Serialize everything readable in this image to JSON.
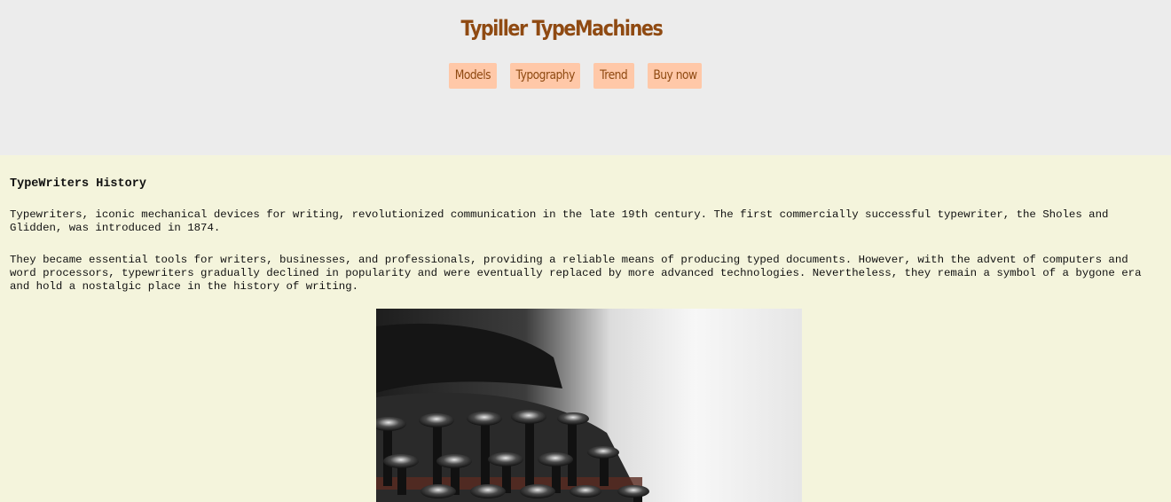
{
  "header": {
    "title": "Typiller TypeMachines",
    "nav": [
      {
        "label": "Models"
      },
      {
        "label": "Typography"
      },
      {
        "label": "Trend"
      },
      {
        "label": "Buy now"
      }
    ]
  },
  "main": {
    "section_title": "TypeWriters History",
    "paragraphs": [
      "Typewriters, iconic mechanical devices for writing, revolutionized communication in the late 19th century. The first commercially successful typewriter, the Sholes and Glidden, was introduced in 1874.",
      "They became essential tools for writers, businesses, and professionals, providing a reliable means of producing typed documents. However, with the advent of computers and word processors, typewriters gradually declined in popularity and were eventually replaced by more advanced technologies. Nevertheless, they remain a symbol of a bygone era and hold a nostalgic place in the history of writing."
    ]
  },
  "colors": {
    "header_bg": "#ececec",
    "page_bg": "#f4f4dc",
    "brand": "#8f4a12",
    "nav_button_bg": "#ffc8a8"
  },
  "icons": {
    "hero": "typewriter-photo"
  }
}
